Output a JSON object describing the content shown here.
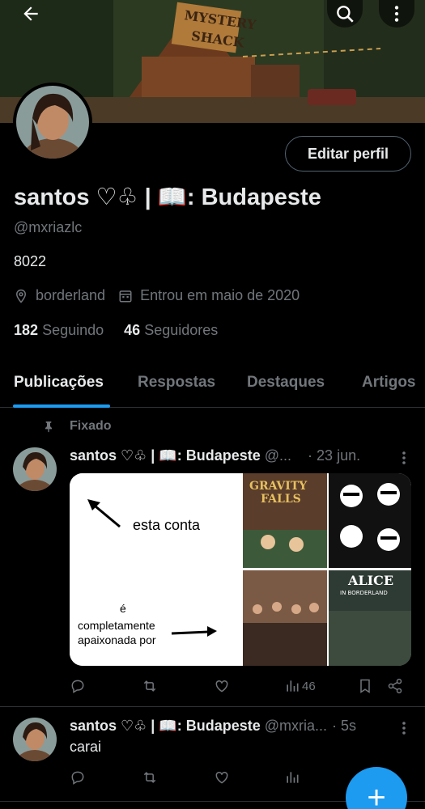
{
  "header": {
    "banner_sign_line1": "MYSTERY",
    "banner_sign_line2": "SHACK"
  },
  "profile": {
    "edit_label": "Editar perfil",
    "name": "santos ♡♧ | 📖: Budapeste",
    "handle": "@mxriazlc",
    "bio": "8022",
    "location": "borderland",
    "joined": "Entrou em maio de 2020",
    "following_count": "182",
    "following_label": "Seguindo",
    "followers_count": "46",
    "followers_label": "Seguidores"
  },
  "tabs": [
    {
      "label": "Publicações"
    },
    {
      "label": "Respostas"
    },
    {
      "label": "Destaques"
    },
    {
      "label": "Artigos"
    }
  ],
  "posts": [
    {
      "pinned_label": "Fixado",
      "name": "santos ♡♧ | 📖: Budapeste",
      "handle": "@...",
      "time": "· 23 jun.",
      "media": {
        "left_text_1": "esta conta",
        "left_text_2": "é",
        "left_text_3": "completamente",
        "left_text_4": "apaixonada por",
        "poster_1_title_a": "GRAVITY",
        "poster_1_title_b": "FALLS",
        "poster_4_title": "ALICE",
        "poster_4_sub": "IN BORDERLAND"
      },
      "views": "46"
    },
    {
      "name": "santos ♡♧ | 📖: Budapeste",
      "handle": "@mxria...",
      "time": "· 5s",
      "text": "carai"
    }
  ],
  "fab_label": "+"
}
